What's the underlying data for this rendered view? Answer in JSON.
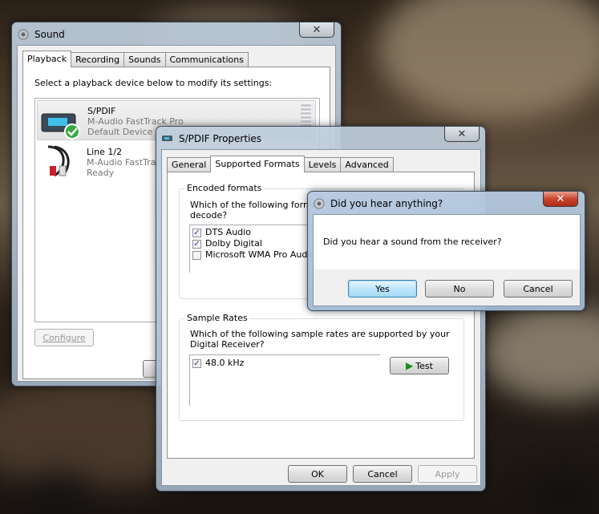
{
  "sound": {
    "title": "Sound",
    "tabs": [
      "Playback",
      "Recording",
      "Sounds",
      "Communications"
    ],
    "instruction": "Select a playback device below to modify its settings:",
    "devices": [
      {
        "name": "S/PDIF",
        "desc": "M-Audio FastTrack Pro",
        "status": "Default Device"
      },
      {
        "name": "Line 1/2",
        "desc": "M-Audio FastTrack Pro",
        "status": "Ready"
      }
    ],
    "configure_label": "Configure",
    "close_symbol": "✕"
  },
  "props": {
    "title": "S/PDIF Properties",
    "tabs": [
      "General",
      "Supported Formats",
      "Levels",
      "Advanced"
    ],
    "encoded": {
      "caption": "Encoded formats",
      "question": "Which of the following formats are supported by your Digital Receiver to decode?",
      "question_line1": "Which of the following forma",
      "question_line2": "decode?",
      "items": [
        {
          "label": "DTS Audio",
          "checked": true
        },
        {
          "label": "Dolby Digital",
          "checked": true
        },
        {
          "label": "Microsoft WMA Pro Audio",
          "checked": false
        }
      ]
    },
    "rates": {
      "caption": "Sample Rates",
      "question_line1": "Which of the following sample rates are supported by your",
      "question_line2": "Digital Receiver?",
      "items": [
        {
          "label": "48.0 kHz",
          "checked": true
        }
      ],
      "test_label": "Test"
    },
    "ok_label": "OK",
    "cancel_label": "Cancel",
    "apply_label": "Apply",
    "close_symbol": "✕"
  },
  "dialog": {
    "title": "Did you hear anything?",
    "message": "Did you hear a sound from the receiver?",
    "yes_label": "Yes",
    "no_label": "No",
    "cancel_label": "Cancel",
    "close_symbol": "✕"
  },
  "icons": {
    "check": "✓",
    "play": "▶"
  }
}
